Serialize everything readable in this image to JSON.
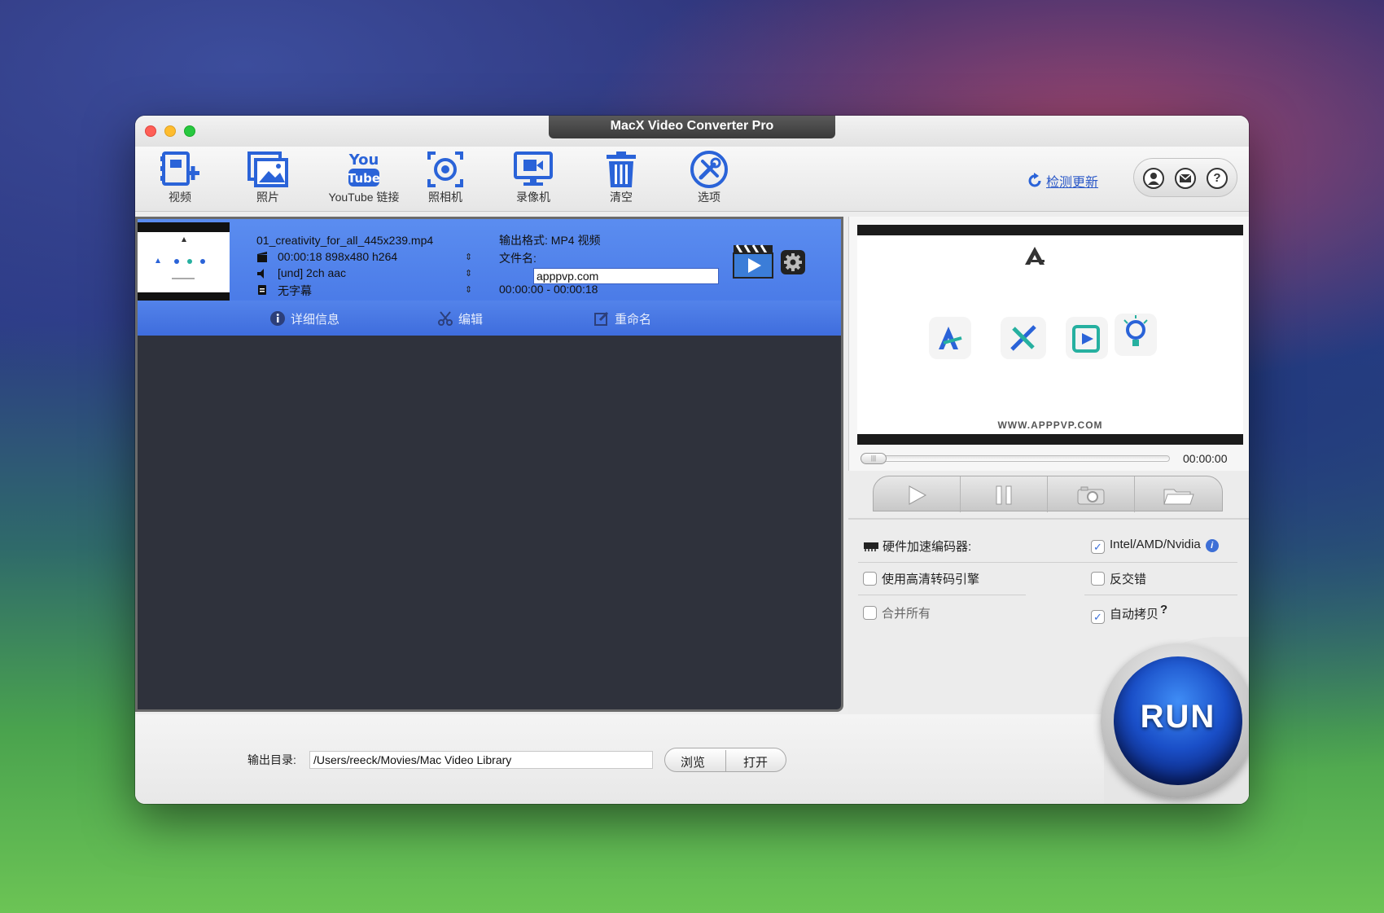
{
  "window": {
    "title": "MacX Video Converter Pro"
  },
  "toolbar": {
    "items": [
      {
        "label": "视频"
      },
      {
        "label": "照片"
      },
      {
        "label": "YouTube 链接"
      },
      {
        "label": "照相机"
      },
      {
        "label": "录像机"
      },
      {
        "label": "清空"
      },
      {
        "label": "选项"
      }
    ],
    "update_label": "检测更新",
    "help_label": "?"
  },
  "file": {
    "name": "01_creativity_for_all_445x239.mp4",
    "video_info": "00:00:18 898x480 h264",
    "audio_info": "[und] 2ch aac",
    "subtitle_info": "无字幕",
    "output_format": "输出格式: MP4 视频",
    "filename_label": "文件名:",
    "filename_value": "apppvp.com",
    "time_range": "00:00:00 - 00:00:18",
    "actions": [
      {
        "label": "详细信息"
      },
      {
        "label": "编辑"
      },
      {
        "label": "重命名"
      }
    ]
  },
  "output": {
    "label": "输出目录:",
    "path": "/Users/reeck/Movies/Mac Video Library",
    "browse_label": "浏览",
    "open_label": "打开"
  },
  "preview": {
    "watermark": "WWW.APPPVP.COM",
    "timecode": "00:00:00"
  },
  "options": {
    "hw_encoder_label": "硬件加速编码器:",
    "hw_encoder_value": "Intel/AMD/Nvidia",
    "hw_encoder_checked": true,
    "hq_engine_label": "使用高清转码引擎",
    "hq_engine_checked": false,
    "deinterlace_label": "反交错",
    "deinterlace_checked": false,
    "merge_label": "合并所有",
    "merge_checked": false,
    "autocopy_label": "自动拷贝",
    "autocopy_checked": true,
    "info_mark": "i",
    "question_mark": "?"
  },
  "run": {
    "label": "RUN"
  },
  "colors": {
    "accent": "#4474e4",
    "list_bg": "#2f323c",
    "run_blue": "#1a4fc8",
    "icon_blue": "#2a63d8"
  }
}
